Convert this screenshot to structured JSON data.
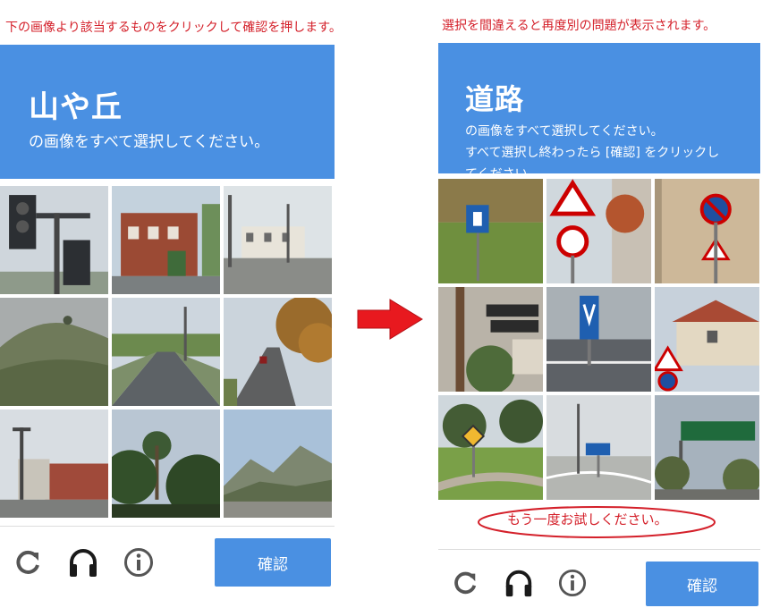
{
  "left": {
    "caption": "下の画像より該当するものをクリックして確認を押します。",
    "title": "山や丘",
    "subtitle": "の画像をすべて選択してください。",
    "verify_label": "確認",
    "tiles": [
      "traffic-light",
      "brick-building",
      "street-corner",
      "grassy-hill",
      "road-with-trees",
      "autumn-road",
      "town-street",
      "palm-trees",
      "mountain-range"
    ]
  },
  "right": {
    "caption": "選択を間違えると再度別の問題が表示されます。",
    "title": "道路",
    "subtitle_1": "の画像をすべて選択してください。",
    "subtitle_2": "すべて選択し終わったら [確認] をクリックし",
    "subtitle_3": "てください",
    "retry_message": "もう一度お試しください。",
    "verify_label": "確認",
    "tiles": [
      "parking-sign-field",
      "road-signs-tree",
      "no-parking-sign-wall",
      "street-name-sign",
      "blue-arrow-sign-road",
      "warning-sign-house",
      "diamond-sign-park",
      "roundabout-sign",
      "green-direction-sign"
    ]
  },
  "icons": {
    "reload": "reload-icon",
    "audio": "headphones-icon",
    "info": "info-icon",
    "arrow": "red-arrow-icon"
  },
  "colors": {
    "accent": "#4a90e2",
    "caption_red": "#d4202a",
    "arrow_red": "#e8191f"
  }
}
